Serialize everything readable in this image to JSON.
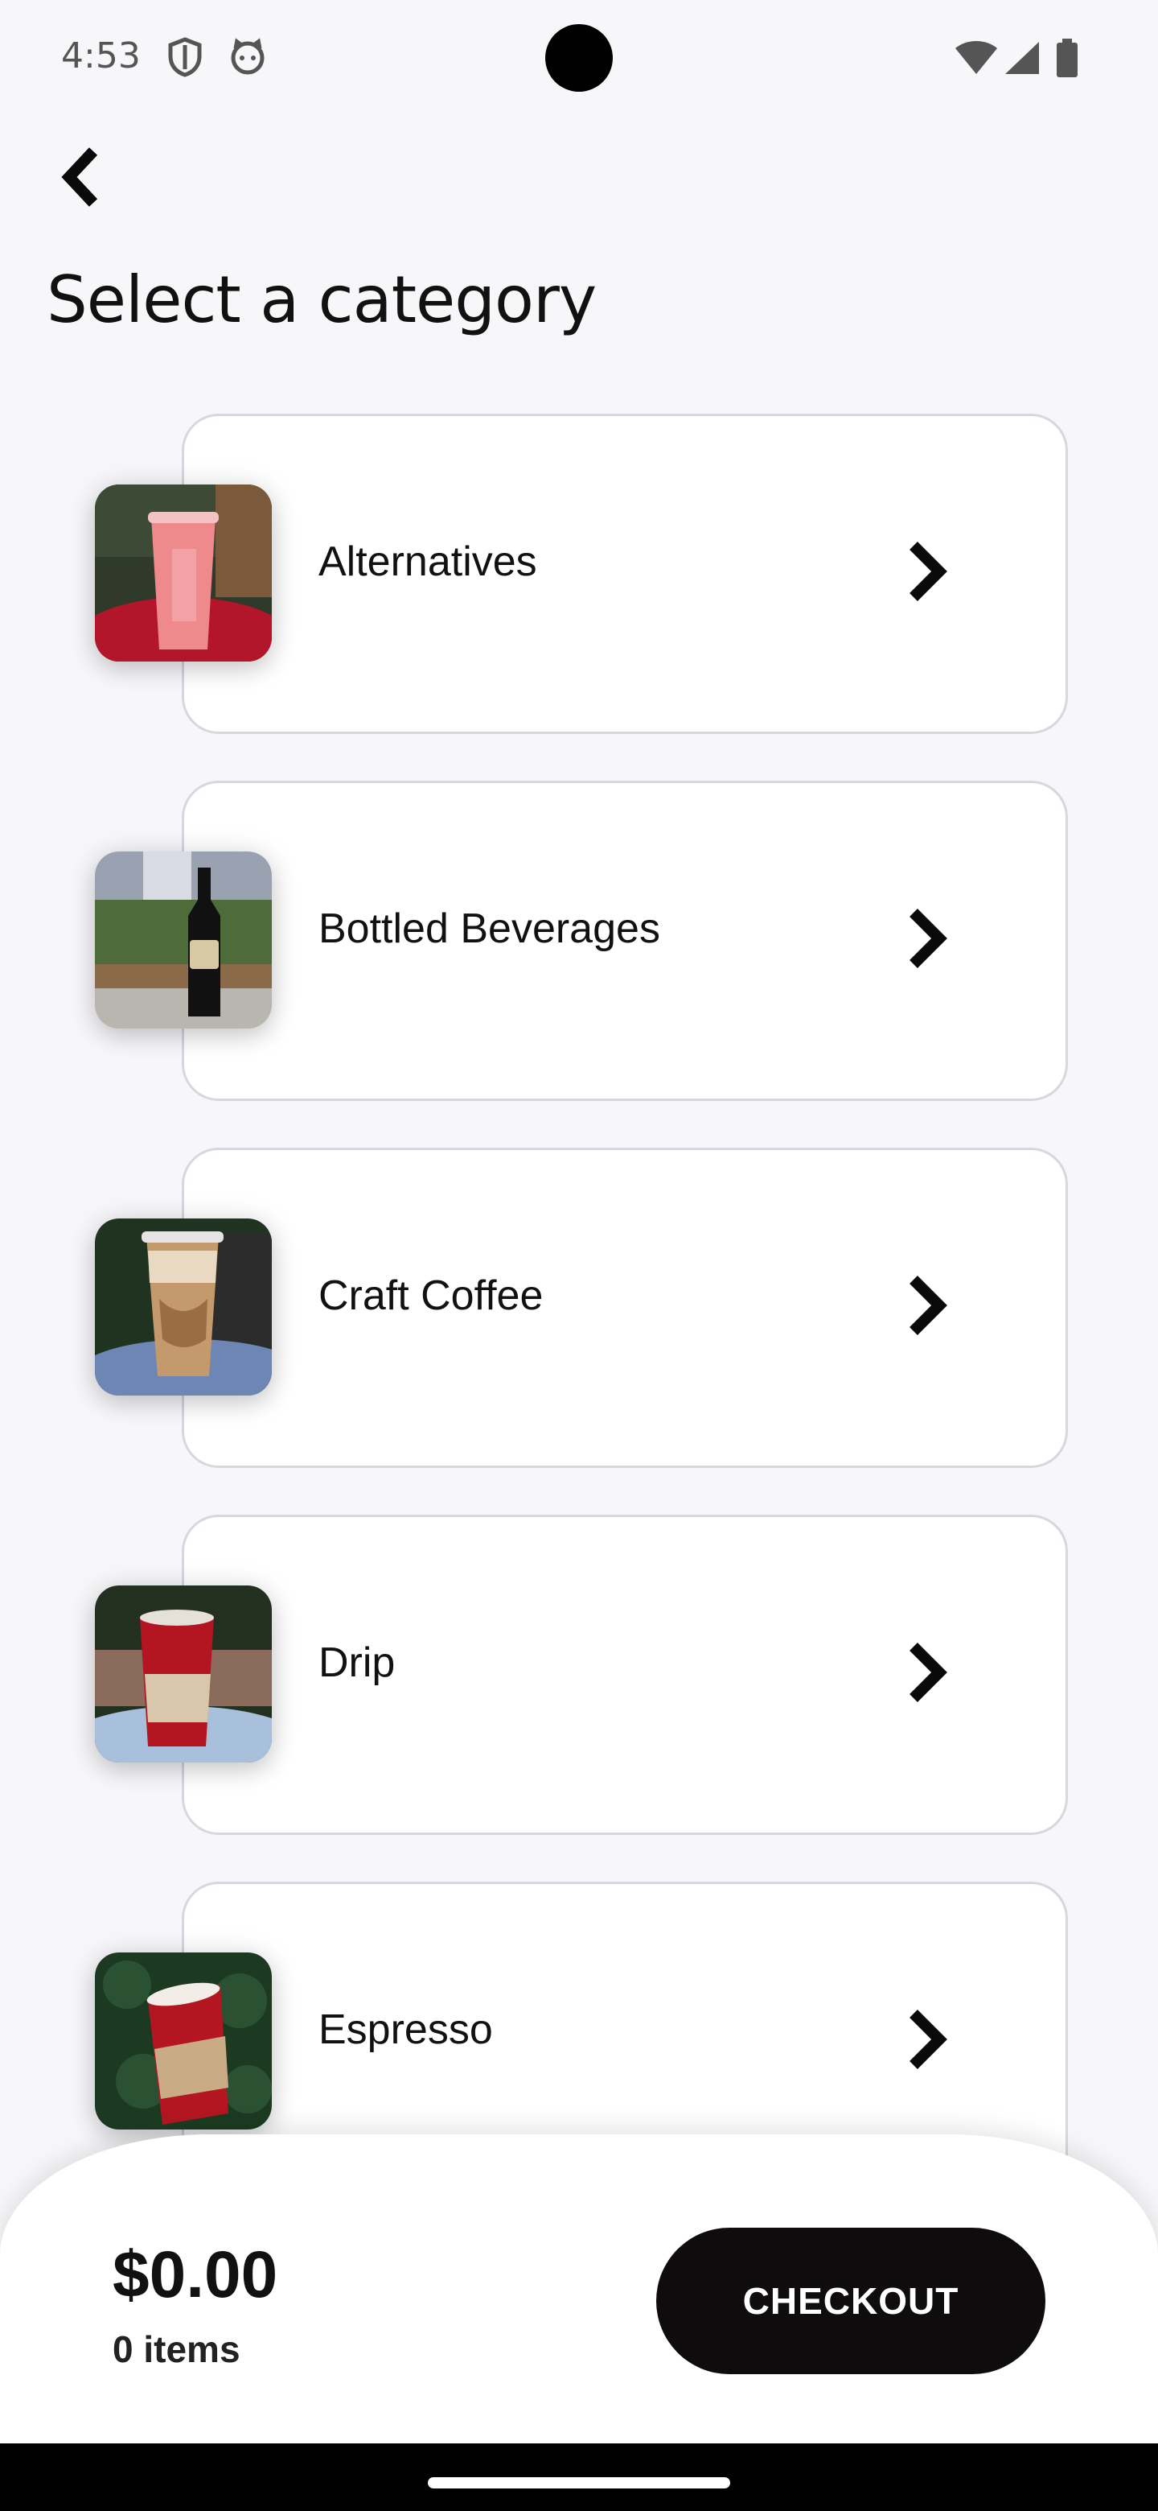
{
  "status_bar": {
    "time": "4:53",
    "left_icons": [
      "shield-icon",
      "cat-face-icon"
    ],
    "right_icons": [
      "wifi-icon",
      "signal-icon",
      "battery-icon"
    ]
  },
  "header": {
    "back_icon": "chevron-left-icon",
    "title": "Select a category"
  },
  "categories": [
    {
      "label": "Alternatives",
      "image": "pink-smoothie-cup",
      "chevron": "chevron-right-icon"
    },
    {
      "label": "Bottled Beverages",
      "image": "dark-glass-bottle-with-plants",
      "chevron": "chevron-right-icon"
    },
    {
      "label": "Craft Coffee",
      "image": "iced-caramel-coffee-cup",
      "chevron": "chevron-right-icon"
    },
    {
      "label": "Drip",
      "image": "red-paper-coffee-cup",
      "chevron": "chevron-right-icon"
    },
    {
      "label": "Espresso",
      "image": "red-cup-with-sleeve",
      "chevron": "chevron-right-icon"
    }
  ],
  "cart": {
    "total": "$0.00",
    "items": "0 items",
    "checkout_label": "CHECKOUT"
  },
  "colors": {
    "background": "#f7f6f9",
    "card_border": "#d9d6de",
    "checkout_bg": "#0e0c0d",
    "text": "#111111"
  }
}
